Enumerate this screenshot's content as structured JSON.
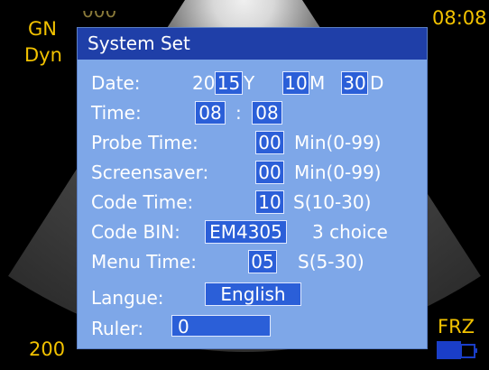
{
  "overlay": {
    "gain_label": "GN",
    "mode_label": "Dyn",
    "depth_top": "000",
    "clock": "08:08",
    "freeze_label": "FRZ",
    "depth_bottom": "200"
  },
  "dialog": {
    "title": "System Set",
    "date": {
      "label": "Date:",
      "century": "20",
      "year": "15",
      "year_unit": "Y",
      "month": "10",
      "month_unit": "M",
      "day": "30",
      "day_unit": "D"
    },
    "time": {
      "label": "Time:",
      "hour": "08",
      "separator": ":",
      "minute": "08"
    },
    "probe_time": {
      "label": "Probe Time:",
      "value": "00",
      "unit": "Min(0-99)"
    },
    "screensaver": {
      "label": "Screensaver:",
      "value": "00",
      "unit": "Min(0-99)"
    },
    "code_time": {
      "label": "Code Time:",
      "value": "10",
      "unit": "S(10-30)"
    },
    "code_bin": {
      "label": "Code BIN:",
      "value": "EM4305",
      "unit": "3 choice"
    },
    "menu_time": {
      "label": "Menu Time:",
      "value": "05",
      "unit": "S(5-30)"
    },
    "langue": {
      "label": "Langue:",
      "value": "English"
    },
    "ruler": {
      "label": "Ruler:",
      "value": "0"
    }
  },
  "colors": {
    "overlay_text": "#f2c200",
    "dialog_bg": "#7ea7e8",
    "title_bar": "#1f3fa8",
    "field_bg": "#2b5fd8",
    "battery": "#1a3ec8"
  },
  "icons": {
    "battery": "battery-icon"
  }
}
